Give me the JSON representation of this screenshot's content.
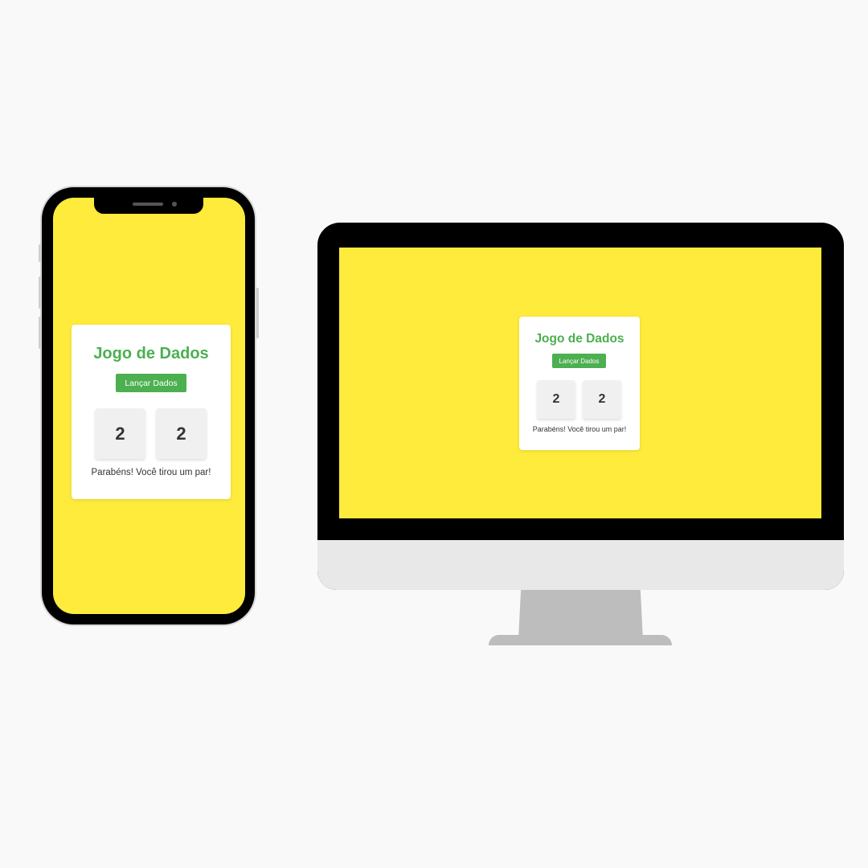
{
  "app": {
    "title": "Jogo de Dados",
    "roll_button_label": "Lançar Dados",
    "dice": [
      "2",
      "2"
    ],
    "result_message": "Parabéns! Você tirou um par!"
  },
  "colors": {
    "page_background": "#f9f9f9",
    "screen_background": "#ffeb3b",
    "accent_green": "#4caf50",
    "device_frame": "#000000",
    "monitor_chin": "#e8e8e8",
    "monitor_stand": "#bdbdbd"
  }
}
